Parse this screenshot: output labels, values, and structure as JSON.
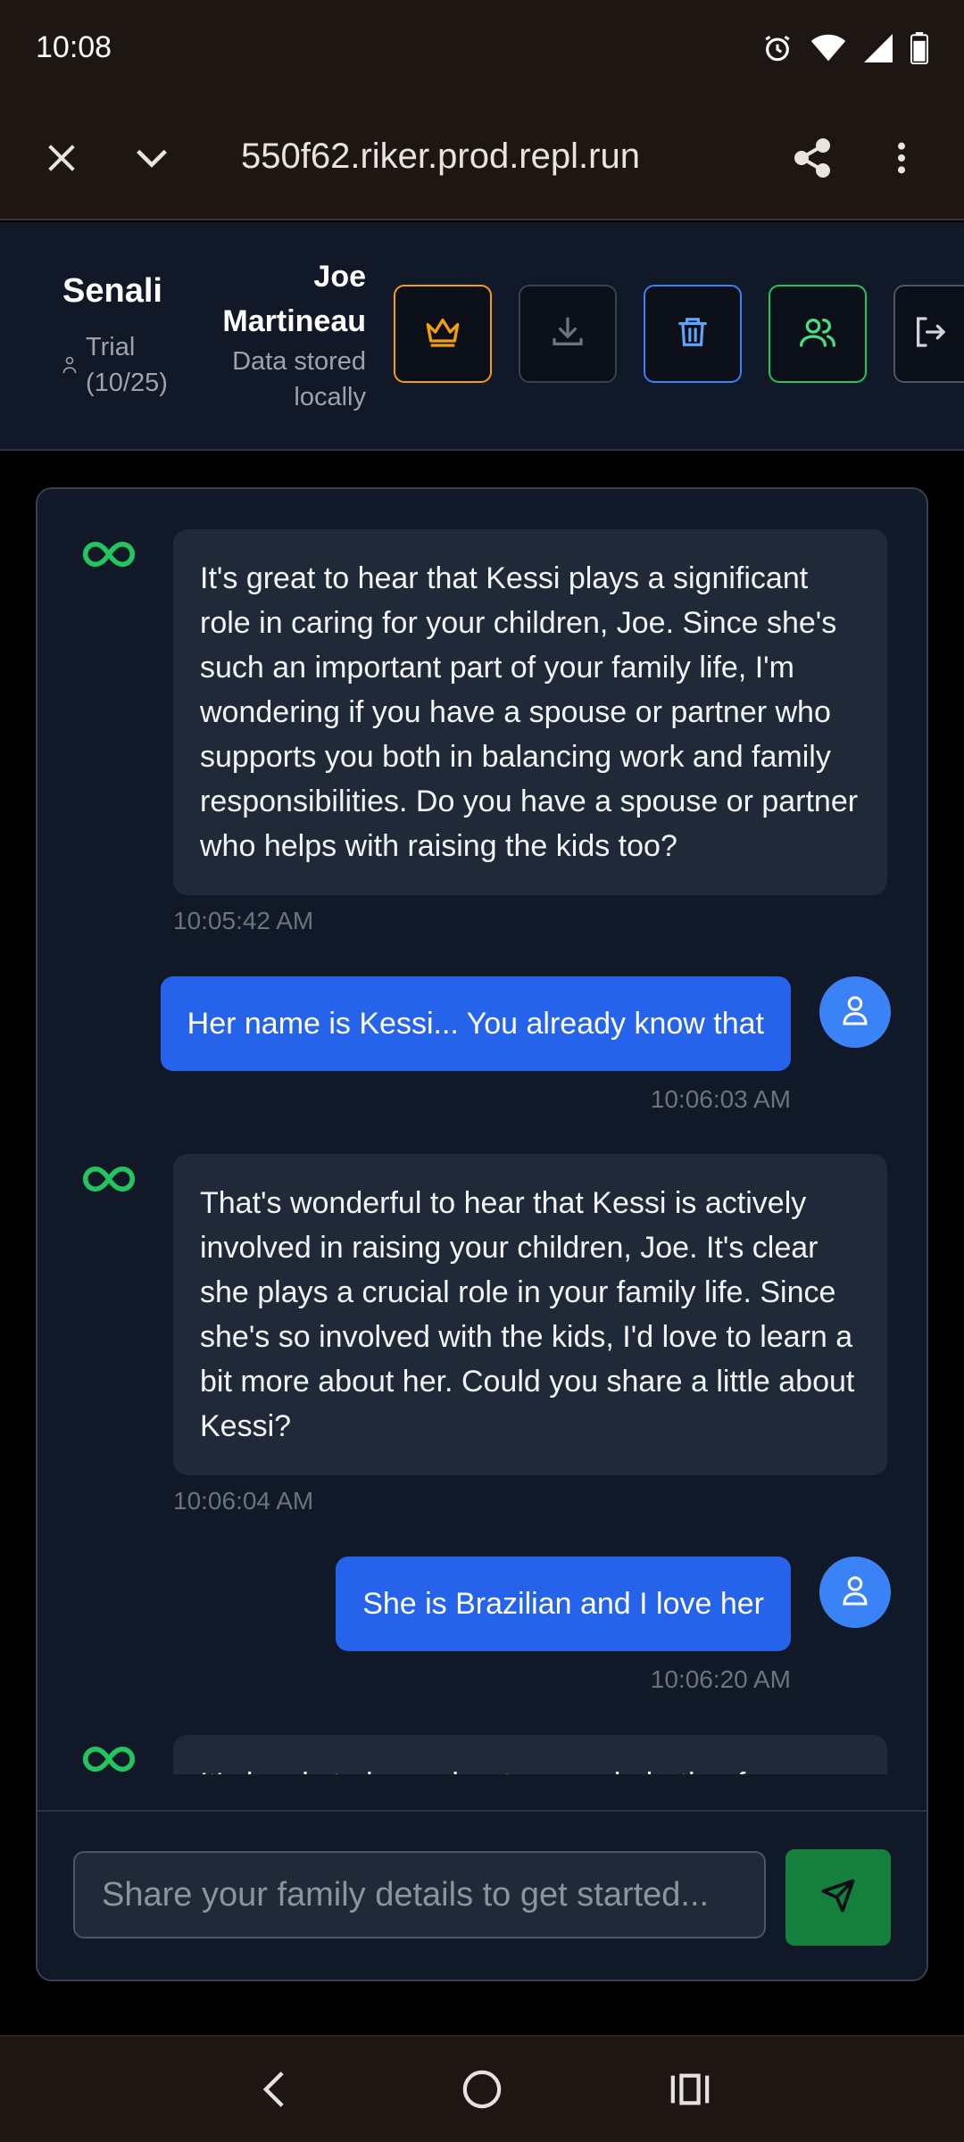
{
  "status_bar": {
    "time": "10:08",
    "icons": [
      "alarm-icon",
      "wifi-icon",
      "signal-icon",
      "battery-icon"
    ]
  },
  "browser": {
    "url": "550f62.riker.prod.repl.run",
    "icons": [
      "close-icon",
      "chevron-down-icon",
      "share-icon",
      "more-vert-icon"
    ]
  },
  "header": {
    "user_name": "Senali",
    "plan": "Trial (10/25)",
    "profile_name": "Joe Martineau",
    "profile_note": "Data stored locally",
    "buttons": [
      {
        "name": "crown-icon",
        "color": "#f59e0b"
      },
      {
        "name": "download-icon",
        "color": "#6b7280"
      },
      {
        "name": "trash-icon",
        "color": "#3b82f6"
      },
      {
        "name": "users-icon",
        "color": "#22c55e"
      },
      {
        "name": "logout-icon",
        "color": "#9ca3af"
      }
    ]
  },
  "messages": [
    {
      "role": "assistant",
      "text": "It's great to hear that Kessi plays a significant role in caring for your children, Joe. Since she's such an important part of your family life, I'm wondering if you have a spouse or partner who supports you both in balancing work and family responsibilities. Do you have a spouse or partner who helps with raising the kids too?",
      "time": "10:05:42 AM"
    },
    {
      "role": "user",
      "text": "Her name is Kessi... You already know that",
      "time": "10:06:03 AM"
    },
    {
      "role": "assistant",
      "text": "That's wonderful to hear that Kessi is actively involved in raising your children, Joe. It's clear she plays a crucial role in your family life. Since she's so involved with the kids, I'd love to learn a bit more about her. Could you share a little about Kessi?",
      "time": "10:06:04 AM"
    },
    {
      "role": "user",
      "text": "She is Brazilian and I love her",
      "time": "10:06:20 AM"
    },
    {
      "role": "assistant",
      "text": "It's lovely to hear about your admiration for",
      "time": ""
    }
  ],
  "input": {
    "placeholder": "Share your family details to get started...",
    "value": ""
  },
  "colors": {
    "accent_green": "#22c55e",
    "user_bubble": "#2563eb",
    "send_button": "#15803d"
  },
  "nav_bar": {
    "icons": [
      "back-icon",
      "home-icon",
      "recents-icon"
    ]
  }
}
